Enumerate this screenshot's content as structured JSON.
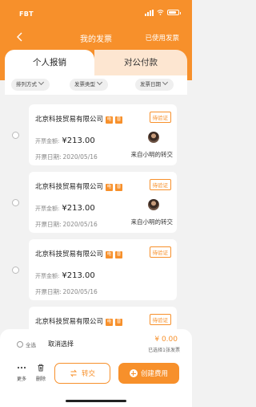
{
  "status_bar": {
    "carrier": "FBT"
  },
  "nav": {
    "title": "我的发票",
    "right_link": "已使用发票"
  },
  "tabs": [
    {
      "label": "个人报销",
      "active": true
    },
    {
      "label": "对公付款",
      "active": false
    }
  ],
  "filters": [
    {
      "label": "排列方式"
    },
    {
      "label": "发票类型"
    },
    {
      "label": "发票日期"
    }
  ],
  "invoice_labels": {
    "amount": "开票金额:",
    "date": "开票日期:"
  },
  "invoices": [
    {
      "company": "北京科技贸易有限公司",
      "tag1": "电",
      "tag2": "普",
      "status": "待验证",
      "amount": "¥213.00",
      "date": "2020/05/16",
      "from": "来自小明的转交",
      "has_avatar": true
    },
    {
      "company": "北京科技贸易有限公司",
      "tag1": "电",
      "tag2": "普",
      "status": "待验证",
      "amount": "¥213.00",
      "date": "2020/05/16",
      "from": "来自小明的转交",
      "has_avatar": true
    },
    {
      "company": "北京科技贸易有限公司",
      "tag1": "电",
      "tag2": "普",
      "status": "待验证",
      "amount": "¥213.00",
      "date": "2020/05/16",
      "from": "",
      "has_avatar": false
    },
    {
      "company": "北京科技贸易有限公司",
      "tag1": "电",
      "tag2": "普",
      "status": "待验证",
      "amount": "",
      "date": "",
      "from": "",
      "has_avatar": false
    }
  ],
  "bottom": {
    "select_all": "全选",
    "cancel_select": "取消选择",
    "total": "¥ 0.00",
    "selected_count": "已选择1张发票",
    "more": "更多",
    "delete": "删除",
    "transfer": "转交",
    "create": "创建费用"
  },
  "colors": {
    "accent": "#f7902b",
    "tab_inactive": "#fde6d1",
    "background": "#f2f2f2"
  }
}
